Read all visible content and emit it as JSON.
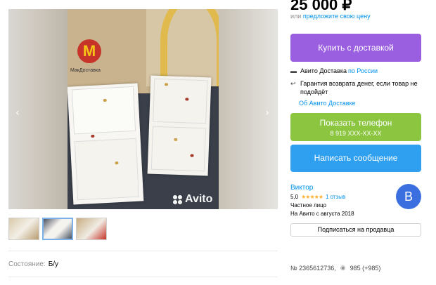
{
  "gallery": {
    "prev_arrow": "‹",
    "next_arrow": "›",
    "photo_bag_text": "МакДоставка",
    "photo_logo": "M",
    "watermark": "Avito"
  },
  "listing": {
    "price": "25 000 ₽",
    "offer_prefix": "или",
    "offer_link": "предложите свою цену",
    "condition_label": "Состояние:",
    "condition_value": "Б/у",
    "item_number": "№ 2365612736,",
    "views": "985 (+985)"
  },
  "actions": {
    "buy_delivery": "Купить с доставкой",
    "show_phone": "Показать телефон",
    "phone_masked": "8 919 XXX-XX-XX",
    "write_message": "Написать сообщение",
    "subscribe": "Подписаться на продавца"
  },
  "delivery": {
    "text": "Авито Доставка",
    "region_link": "по России",
    "guarantee": "Гарантия возврата денег, если товар не подойдёт",
    "about_link": "Об Авито Доставке"
  },
  "seller": {
    "name": "Виктор",
    "rating": "5,0",
    "stars": "★★★★★",
    "reviews": "1 отзыв",
    "type": "Частное лицо",
    "since": "На Авито с августа 2018",
    "avatar_letter": "В"
  },
  "icons": {
    "truck": "truck-icon",
    "return": "return-icon",
    "eye": "eye-icon"
  },
  "colors": {
    "buy": "#9a5fe0",
    "phone": "#8cc641",
    "message": "#2fa0f0",
    "link": "#0091ea",
    "avatar": "#3b6fe0",
    "stars": "#ffb02e"
  }
}
